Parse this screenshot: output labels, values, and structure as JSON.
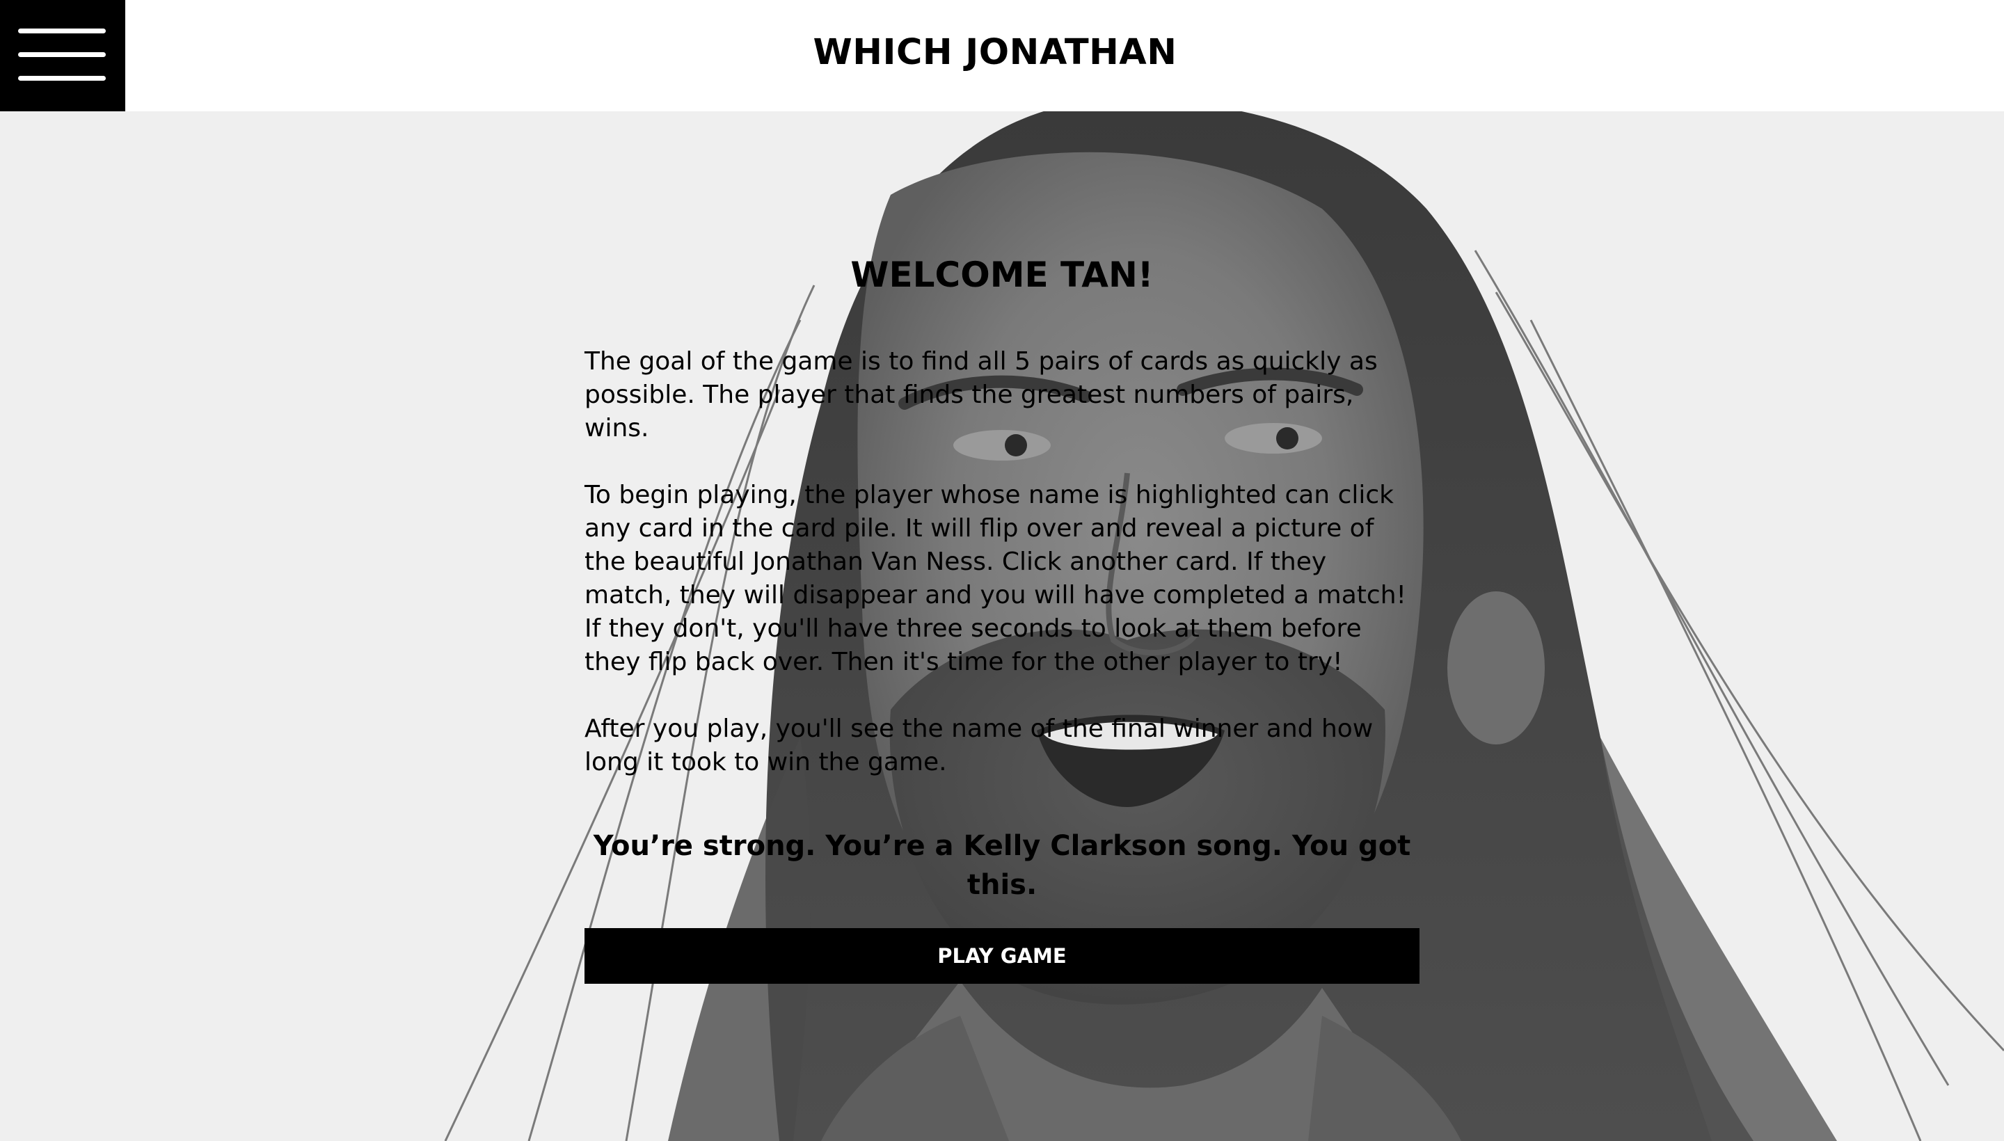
{
  "header": {
    "title": "WHICH JONATHAN",
    "menu_icon": "hamburger-menu-icon"
  },
  "main": {
    "welcome": "WELCOME TAN!",
    "paragraphs": [
      "The goal of the game is to find all 5 pairs of cards as quickly as possible. The player that finds the greatest numbers of pairs, wins.",
      "To begin playing, the player whose name is highlighted can click any card in the card pile. It will flip over and reveal a picture of the beautiful Jonathan Van Ness. Click another card. If they match, they will disappear and you will have completed a match! If they don't, you'll have three seconds to look at them before they flip back over. Then it's time for the other player to try!",
      "After you play, you'll see the name of the final winner and how long it took to win the game."
    ],
    "tagline": "You’re strong. You’re a Kelly Clarkson song. You got this.",
    "play_button": "PLAY GAME"
  },
  "colors": {
    "header_bg": "#ffffff",
    "menu_bg": "#000000",
    "button_bg": "#000000",
    "button_text": "#ffffff",
    "hero_bg": "#efefef"
  }
}
